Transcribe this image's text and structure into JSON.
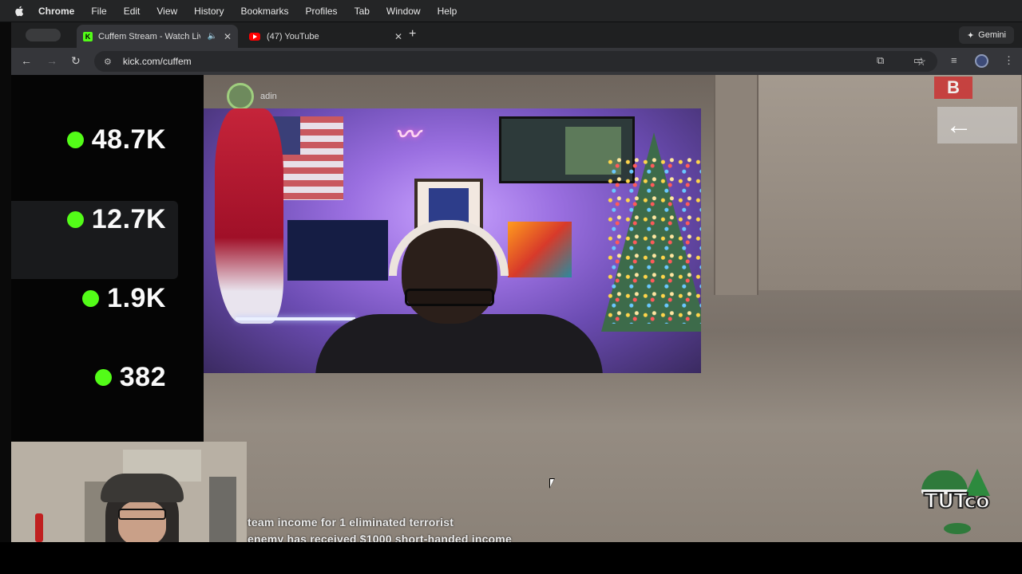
{
  "menubar": {
    "app_name": "Chrome",
    "items": [
      "File",
      "Edit",
      "View",
      "History",
      "Bookmarks",
      "Profiles",
      "Tab",
      "Window",
      "Help"
    ]
  },
  "tabs": [
    {
      "title": "Cuffem Stream - Watch Live on Kick",
      "favicon": "kick-icon",
      "active": true,
      "audio": true
    },
    {
      "title": "(47) YouTube",
      "favicon": "youtube-icon",
      "active": false,
      "audio": false
    }
  ],
  "gemini_label": "Gemini",
  "address_bar": {
    "url": "kick.com/cuffem"
  },
  "stream": {
    "viewer_counts": [
      "48.7K",
      "12.7K",
      "1.9K",
      "382"
    ],
    "status_color": "#53fc18",
    "killfeed_name": "adin",
    "game_messages": [
      "team income for 1 eliminated terrorist",
      "enemy has received $1000 short-handed income"
    ],
    "sign_letter": "B",
    "logo_text": "TUTco"
  }
}
